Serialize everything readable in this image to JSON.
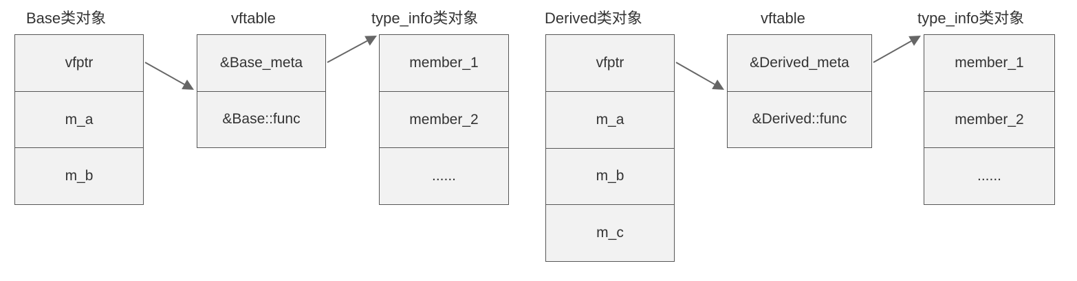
{
  "base": {
    "object": {
      "title": "Base类对象",
      "fields": [
        "vfptr",
        "m_a",
        "m_b"
      ]
    },
    "vftable": {
      "title": "vftable",
      "entries": [
        "&Base_meta",
        "&Base::func"
      ]
    },
    "type_info": {
      "title": "type_info类对象",
      "members": [
        "member_1",
        "member_2",
        "......"
      ]
    }
  },
  "derived": {
    "object": {
      "title": "Derived类对象",
      "fields": [
        "vfptr",
        "m_a",
        "m_b",
        "m_c"
      ]
    },
    "vftable": {
      "title": "vftable",
      "entries": [
        "&Derived_meta",
        "&Derived::func"
      ]
    },
    "type_info": {
      "title": "type_info类对象",
      "members": [
        "member_1",
        "member_2",
        "......"
      ]
    }
  },
  "colors": {
    "fill": "#f2f2f2",
    "stroke": "#555555",
    "arrow": "#666666",
    "text": "#333333"
  }
}
